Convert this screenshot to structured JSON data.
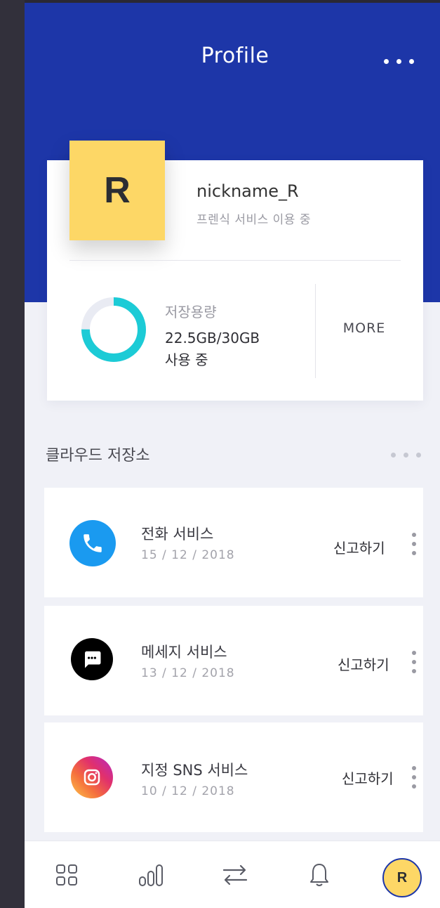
{
  "header": {
    "title": "Profile",
    "menu_icon": "more-horizontal-icon"
  },
  "profile": {
    "avatar_letter": "R",
    "nickname": "nickname_R",
    "subtext": "프렌식 서비스 이용 중",
    "storage_label": "저장용량",
    "storage_value": "22.5GB/30GB",
    "storage_unit": "사용 중",
    "storage_fraction": 0.75,
    "more_label": "MORE",
    "accent": "#1ccbd6",
    "track": "#e9ebf3"
  },
  "section": {
    "title": "클라우드 저장소",
    "menu_icon": "more-horizontal-icon"
  },
  "items": [
    {
      "title": "전화 서비스",
      "date": "15 / 12 / 2018",
      "action": "신고하기",
      "icon": "phone-icon",
      "icon_color": "#1a9af0"
    },
    {
      "title": "메세지 서비스",
      "date": "13 / 12 / 2018",
      "action": "신고하기",
      "icon": "message-icon",
      "icon_color": "#000000"
    },
    {
      "title": "지정 SNS 서비스",
      "date": "10 / 12 / 2018",
      "action": "신고하기",
      "icon": "instagram-icon",
      "icon_color": "#e1306c"
    }
  ],
  "bottom_nav": {
    "items": [
      "grid-icon",
      "bar-chart-icon",
      "transfer-icon",
      "bell-icon",
      "profile-avatar"
    ],
    "avatar_letter": "R"
  },
  "colors": {
    "primary": "#1d36a8",
    "avatar": "#fdd766",
    "background": "#f0f1f7"
  }
}
